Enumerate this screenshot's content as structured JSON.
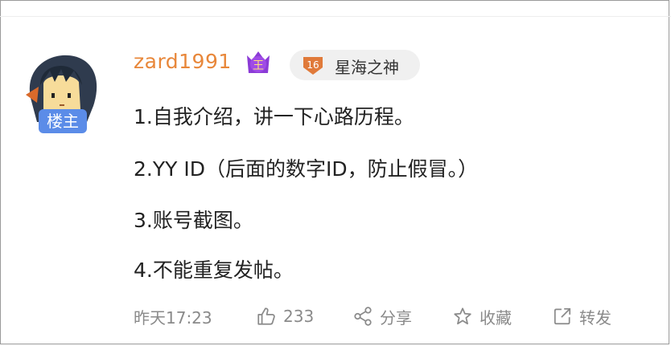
{
  "post": {
    "op_badge": "楼主",
    "username": "zard1991",
    "crown_icon": "crown-wang-icon",
    "level_number": "16",
    "level_title": "星海之神",
    "lines": [
      "1.自我介绍，讲一下心路历程。",
      "2.YY ID（后面的数字ID，防止假冒。）",
      "3.账号截图。",
      "4.不能重复发帖。"
    ],
    "footer": {
      "time": "昨天17:23",
      "likes": "233",
      "share_label": "分享",
      "favorite_label": "收藏",
      "repost_label": "转发"
    }
  },
  "colors": {
    "username": "#e8873a",
    "op_badge_bg": "#5b8ce8",
    "level_pill_bg": "#f0f0f0",
    "footer_text": "#8a8a8a",
    "crown_purple": "#8b3bd6"
  }
}
